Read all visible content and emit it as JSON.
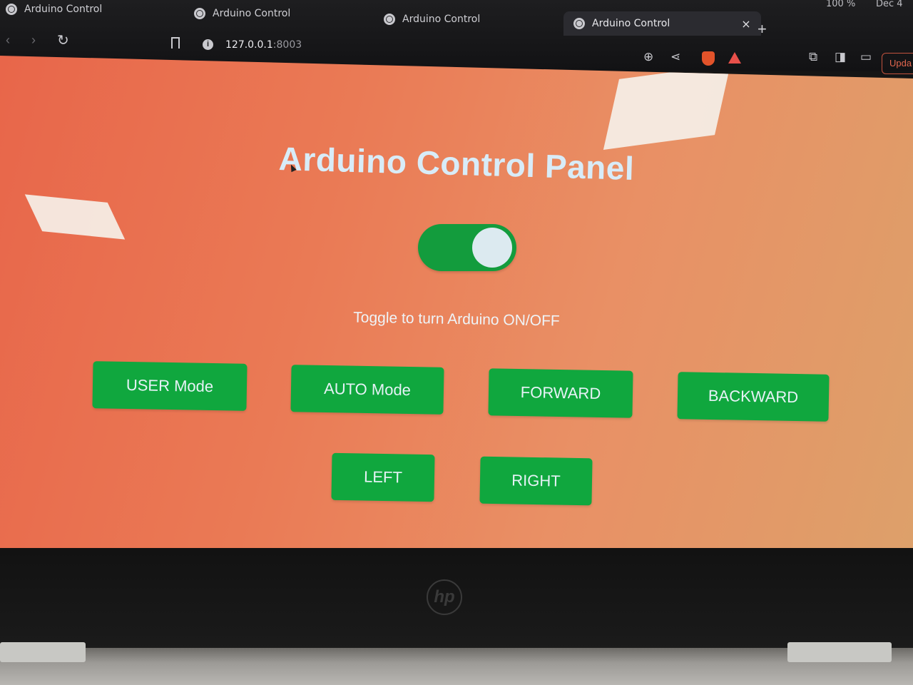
{
  "browser": {
    "tabs": [
      {
        "label": "Arduino Control"
      },
      {
        "label": "Arduino Control"
      },
      {
        "label": "Arduino Control"
      },
      {
        "label": "Arduino Control",
        "active": true
      }
    ],
    "new_tab": "+",
    "close_tab": "×",
    "system": {
      "battery": "100 %",
      "date": "Dec 4"
    },
    "url_host": "127.0.0.1",
    "url_port": ":8003",
    "update_label": "Upda"
  },
  "page": {
    "title": "Arduino Control Panel",
    "toggle_on": true,
    "toggle_caption": "Toggle to turn Arduino ON/OFF",
    "buttons": {
      "user_mode": "USER Mode",
      "auto_mode": "AUTO Mode",
      "forward": "FORWARD",
      "backward": "BACKWARD",
      "left": "LEFT",
      "right": "RIGHT"
    }
  },
  "bezel": {
    "logo": "hp"
  },
  "colors": {
    "button_green": "#10a73e",
    "toggle_green": "#139c3d",
    "title_text": "#d8ecf8",
    "page_bg_start": "#e8664a",
    "page_bg_end": "#dda06a"
  }
}
